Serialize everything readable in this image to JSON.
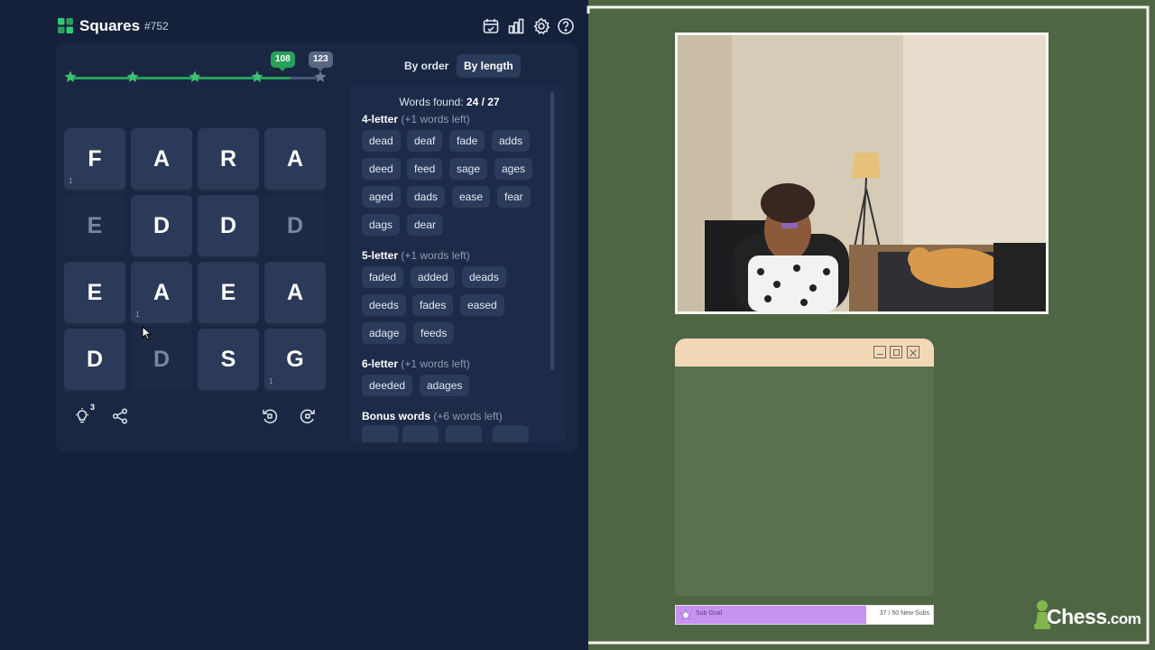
{
  "header": {
    "app_title": "Squares",
    "puzzle_number": "#752",
    "icons": [
      "calendar-icon",
      "stats-icon",
      "settings-icon",
      "help-icon"
    ]
  },
  "progress": {
    "current_score": "108",
    "max_score": "123",
    "fraction": 0.878,
    "milestones_reached": 4
  },
  "grid": {
    "tiles": [
      {
        "letter": "F",
        "count": "1",
        "dim": false
      },
      {
        "letter": "A",
        "count": "",
        "dim": false
      },
      {
        "letter": "R",
        "count": "",
        "dim": false
      },
      {
        "letter": "A",
        "count": "",
        "dim": false
      },
      {
        "letter": "E",
        "count": "",
        "dim": true
      },
      {
        "letter": "D",
        "count": "",
        "dim": false
      },
      {
        "letter": "D",
        "count": "",
        "dim": false
      },
      {
        "letter": "D",
        "count": "",
        "dim": true
      },
      {
        "letter": "E",
        "count": "",
        "dim": false
      },
      {
        "letter": "A",
        "count": "1",
        "dim": false
      },
      {
        "letter": "E",
        "count": "",
        "dim": false
      },
      {
        "letter": "A",
        "count": "",
        "dim": false
      },
      {
        "letter": "D",
        "count": "",
        "dim": false
      },
      {
        "letter": "D",
        "count": "",
        "dim": true
      },
      {
        "letter": "S",
        "count": "",
        "dim": false
      },
      {
        "letter": "G",
        "count": "1",
        "dim": false
      }
    ]
  },
  "tools": {
    "hints_remaining": "3"
  },
  "sort": {
    "by_order": "By order",
    "by_length": "By length",
    "active": "By length"
  },
  "words": {
    "found_label": "Words found:",
    "found_count": "24 / 27",
    "groups": [
      {
        "title": "4-letter",
        "note": "(+1 words left)",
        "words": [
          "dead",
          "deaf",
          "fade",
          "adds",
          "deed",
          "feed",
          "sage",
          "ages",
          "aged",
          "dads",
          "ease",
          "fear",
          "dags",
          "dear"
        ]
      },
      {
        "title": "5-letter",
        "note": "(+1 words left)",
        "words": [
          "faded",
          "added",
          "deads",
          "deeds",
          "fades",
          "eased",
          "adage",
          "feeds"
        ]
      },
      {
        "title": "6-letter",
        "note": "(+1 words left)",
        "words": [
          "deeded",
          "adages"
        ]
      },
      {
        "title": "Bonus words",
        "note": "(+6 words left)",
        "words": []
      }
    ]
  },
  "stream": {
    "sub_goal_label": "Sub Goal",
    "sub_goal_count": "37 / 50 New Subs",
    "sub_goal_fraction": 0.74,
    "brand": "Chess",
    "brand_suffix": ".com"
  },
  "colors": {
    "accent_green": "#27a05a",
    "panel_bg": "#15213a",
    "stream_bg": "#4f6645",
    "sub_goal_fill": "#c792f2"
  }
}
